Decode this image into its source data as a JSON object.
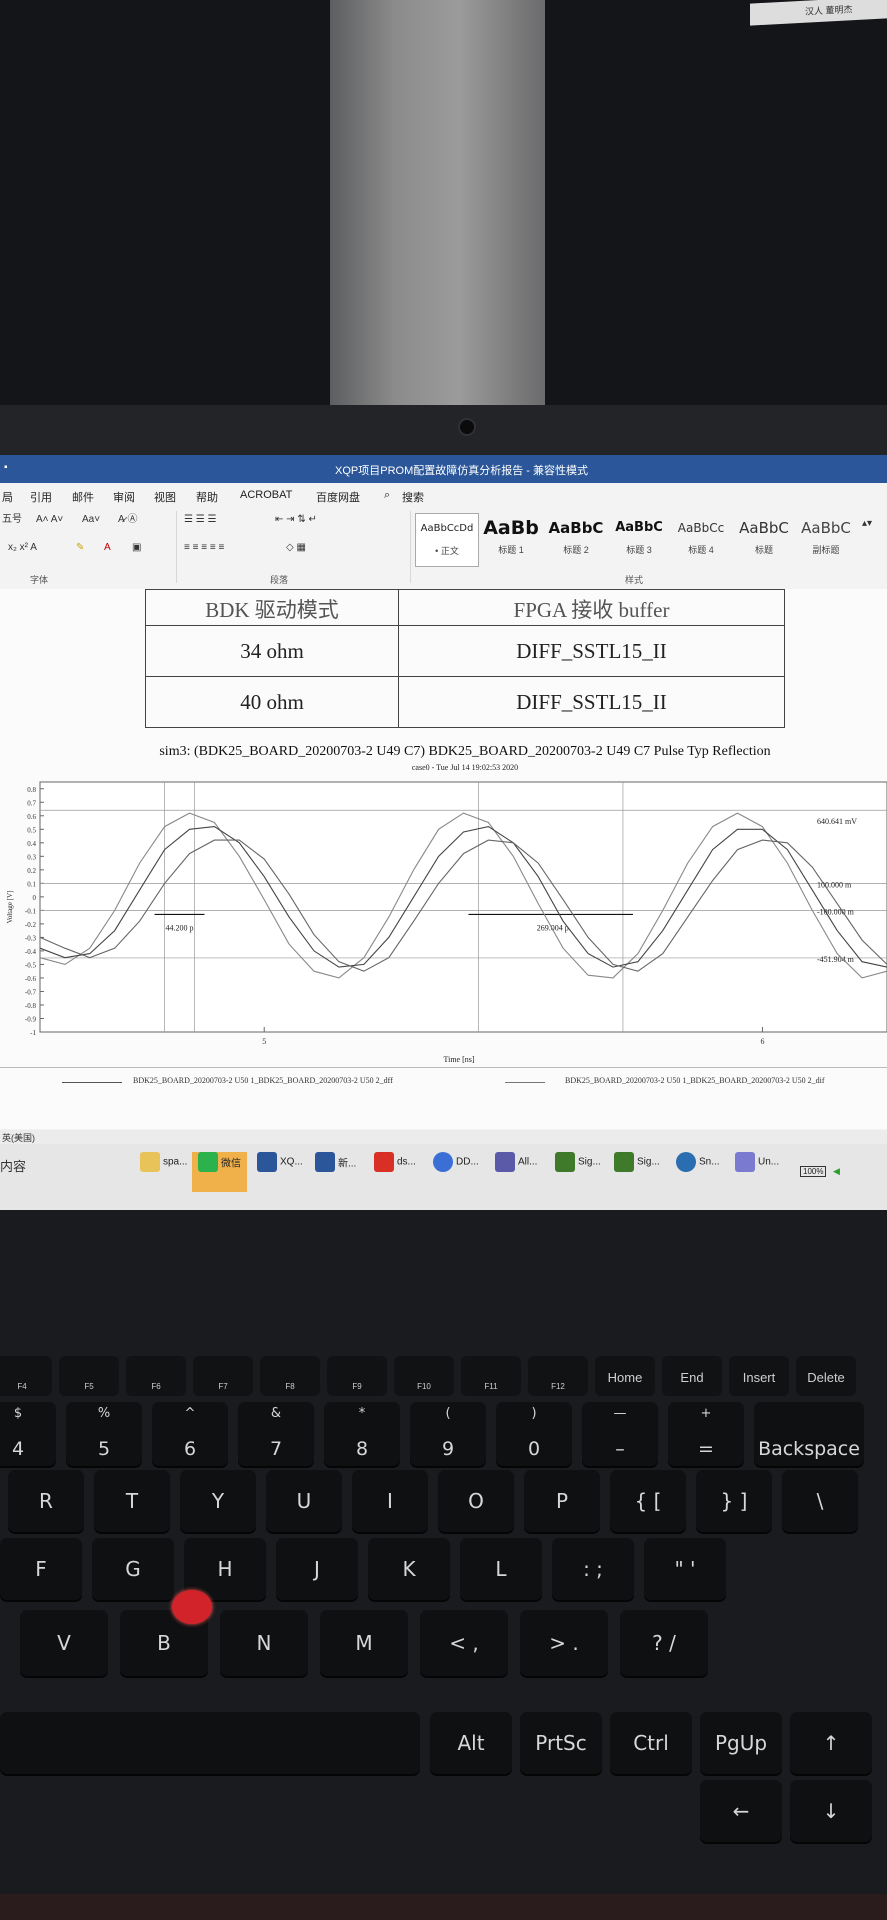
{
  "window": {
    "title": "XQP项目PROM配置故障仿真分析报告 - 兼容性模式"
  },
  "menu": [
    "局",
    "引用",
    "邮件",
    "审阅",
    "视图",
    "帮助",
    "ACROBAT",
    "百度网盘",
    "搜索"
  ],
  "ribbon": {
    "font_size": "五号",
    "group_font": "字体",
    "group_paragraph": "段落",
    "group_styles": "样式",
    "styles": [
      {
        "preview": "AaBbCcDd",
        "name": "• 正文"
      },
      {
        "preview": "AaBb",
        "name": "标题 1"
      },
      {
        "preview": "AaBbC",
        "name": "标题 2"
      },
      {
        "preview": "AaBbC",
        "name": "标题 3"
      },
      {
        "preview": "AaBbCc",
        "name": "标题 4"
      },
      {
        "preview": "AaBbC",
        "name": "标题"
      },
      {
        "preview": "AaBbC",
        "name": "副标题"
      }
    ]
  },
  "doc_table": {
    "rows": [
      {
        "c1": "BDK 驱动模式",
        "c2": "FPGA 接收 buffer"
      },
      {
        "c1": "34 ohm",
        "c2": "DIFF_SSTL15_II"
      },
      {
        "c1": "40 ohm",
        "c2": "DIFF_SSTL15_II"
      }
    ]
  },
  "figure": {
    "title": "sim3: (BDK25_BOARD_20200703-2 U49 C7) BDK25_BOARD_20200703-2 U49 C7 Pulse Typ Reflection",
    "subtitle": "case0 - Tue Jul 14 19:02:53 2020",
    "legend_left": "BDK25_BOARD_20200703-2 U50 1_BDK25_BOARD_20200703-2 U50 2_dff",
    "legend_right": "BDK25_BOARD_20200703-2 U50 1_BDK25_BOARD_20200703-2 U50 2_dif"
  },
  "chart_data": {
    "type": "line",
    "title": "",
    "xlabel": "Time [ns]",
    "ylabel": "Voltage [V]",
    "xlim": [
      4.55,
      6.25
    ],
    "ylim": [
      -1,
      0.85
    ],
    "xticks": [
      5,
      6
    ],
    "yticks": [
      0.8,
      0.7,
      0.6,
      0.5,
      0.4,
      0.3,
      0.2,
      0.1,
      0,
      -0.1,
      -0.2,
      -0.3,
      -0.4,
      -0.5,
      -0.6,
      -0.7,
      -0.8,
      -0.9,
      -1
    ],
    "ytick_labels": [
      "0.8",
      "0.7",
      "0.6",
      "0.5",
      "0.4",
      "0.3",
      "0.2",
      "0.1",
      "0",
      "-0.1",
      "-0.2",
      "-0.3",
      "-0.4",
      "-0.5",
      "-0.6",
      "-0.7",
      "-0.8",
      "-0.9",
      "-1"
    ],
    "series": [
      {
        "x": [
          4.55,
          4.6,
          4.65,
          4.7,
          4.75,
          4.8,
          4.85,
          4.9,
          4.95,
          5.0,
          5.05,
          5.1,
          5.15,
          5.2,
          5.25,
          5.3,
          5.35,
          5.4,
          5.45,
          5.5,
          5.55,
          5.6,
          5.65,
          5.7,
          5.75,
          5.8,
          5.85,
          5.9,
          5.95,
          6.0,
          6.05,
          6.1,
          6.15,
          6.2,
          6.25
        ],
        "values": [
          -0.45,
          -0.5,
          -0.38,
          -0.1,
          0.25,
          0.52,
          0.62,
          0.55,
          0.3,
          -0.02,
          -0.35,
          -0.55,
          -0.6,
          -0.45,
          -0.15,
          0.2,
          0.5,
          0.62,
          0.55,
          0.3,
          -0.05,
          -0.38,
          -0.58,
          -0.6,
          -0.42,
          -0.1,
          0.25,
          0.52,
          0.62,
          0.52,
          0.25,
          -0.1,
          -0.42,
          -0.6,
          -0.55
        ]
      },
      {
        "x": [
          4.55,
          4.6,
          4.65,
          4.7,
          4.75,
          4.8,
          4.85,
          4.9,
          4.95,
          5.0,
          5.05,
          5.1,
          5.15,
          5.2,
          5.25,
          5.3,
          5.35,
          5.4,
          5.45,
          5.5,
          5.55,
          5.6,
          5.65,
          5.7,
          5.75,
          5.8,
          5.85,
          5.9,
          5.95,
          6.0,
          6.05,
          6.1,
          6.15,
          6.2,
          6.25
        ],
        "values": [
          -0.38,
          -0.45,
          -0.42,
          -0.25,
          0.05,
          0.35,
          0.5,
          0.52,
          0.4,
          0.15,
          -0.15,
          -0.4,
          -0.52,
          -0.5,
          -0.3,
          0.0,
          0.3,
          0.48,
          0.52,
          0.4,
          0.15,
          -0.18,
          -0.42,
          -0.52,
          -0.48,
          -0.25,
          0.05,
          0.35,
          0.5,
          0.5,
          0.35,
          0.05,
          -0.25,
          -0.48,
          -0.52
        ]
      },
      {
        "x": [
          4.55,
          4.6,
          4.65,
          4.7,
          4.75,
          4.8,
          4.85,
          4.9,
          4.95,
          5.0,
          5.05,
          5.1,
          5.15,
          5.2,
          5.25,
          5.3,
          5.35,
          5.4,
          5.45,
          5.5,
          5.55,
          5.6,
          5.65,
          5.7,
          5.75,
          5.8,
          5.85,
          5.9,
          5.95,
          6.0,
          6.05,
          6.1,
          6.15,
          6.2,
          6.25
        ],
        "values": [
          -0.3,
          -0.38,
          -0.45,
          -0.38,
          -0.18,
          0.1,
          0.32,
          0.42,
          0.42,
          0.28,
          0.02,
          -0.28,
          -0.48,
          -0.55,
          -0.45,
          -0.18,
          0.1,
          0.32,
          0.42,
          0.4,
          0.25,
          -0.02,
          -0.3,
          -0.5,
          -0.55,
          -0.42,
          -0.15,
          0.12,
          0.35,
          0.42,
          0.4,
          0.22,
          -0.05,
          -0.32,
          -0.5
        ]
      }
    ],
    "hlines": [
      0.641,
      0.1,
      -0.1,
      -0.452
    ],
    "hline_labels": [
      "640.641 mV",
      "100.000 m",
      "-100.000 m",
      "-451.904 m"
    ],
    "markers": [
      {
        "x1": 4.8,
        "x2": 4.86,
        "y": -0.13,
        "label": "44.200 p"
      },
      {
        "x1": 5.43,
        "x2": 5.72,
        "y": -0.13,
        "label": "269.004 p"
      }
    ]
  },
  "statusbar": {
    "lang": "英(美国)"
  },
  "taskbar": {
    "search": "内容",
    "items": [
      "spa...",
      "微信",
      "XQ...",
      "新...",
      "ds...",
      "DD...",
      "All...",
      "Sig...",
      "Sig...",
      "Sn...",
      "Un..."
    ],
    "battery": "100%"
  },
  "keyboard": {
    "fn_row": [
      "F4",
      "F5",
      "F6",
      "F7",
      "F8",
      "F9",
      "F10",
      "F11",
      "F12",
      "Home",
      "End",
      "Insert",
      "Delete"
    ],
    "num_row": [
      [
        "$",
        "4"
      ],
      [
        "%",
        "5"
      ],
      [
        "^",
        "6"
      ],
      [
        "&",
        "7"
      ],
      [
        "*",
        "8"
      ],
      [
        "(",
        "9"
      ],
      [
        ")",
        "0"
      ],
      [
        "—",
        "–"
      ],
      [
        "+",
        "="
      ],
      [
        "",
        "Backspace"
      ]
    ],
    "row_r": [
      "R",
      "T",
      "Y",
      "U",
      "I",
      "O",
      "P",
      "{ [",
      "} ]",
      "\\"
    ],
    "row_f": [
      "F",
      "G",
      "H",
      "J",
      "K",
      "L",
      ": ;",
      "\" '"
    ],
    "row_v": [
      "V",
      "B",
      "N",
      "M",
      "< ,",
      "> .",
      "? /"
    ],
    "row_bottom": [
      "Alt",
      "PrtSc",
      "Ctrl",
      "PgUp",
      "↑",
      "←",
      "↓"
    ],
    "sticker": "汉人 董明杰"
  }
}
